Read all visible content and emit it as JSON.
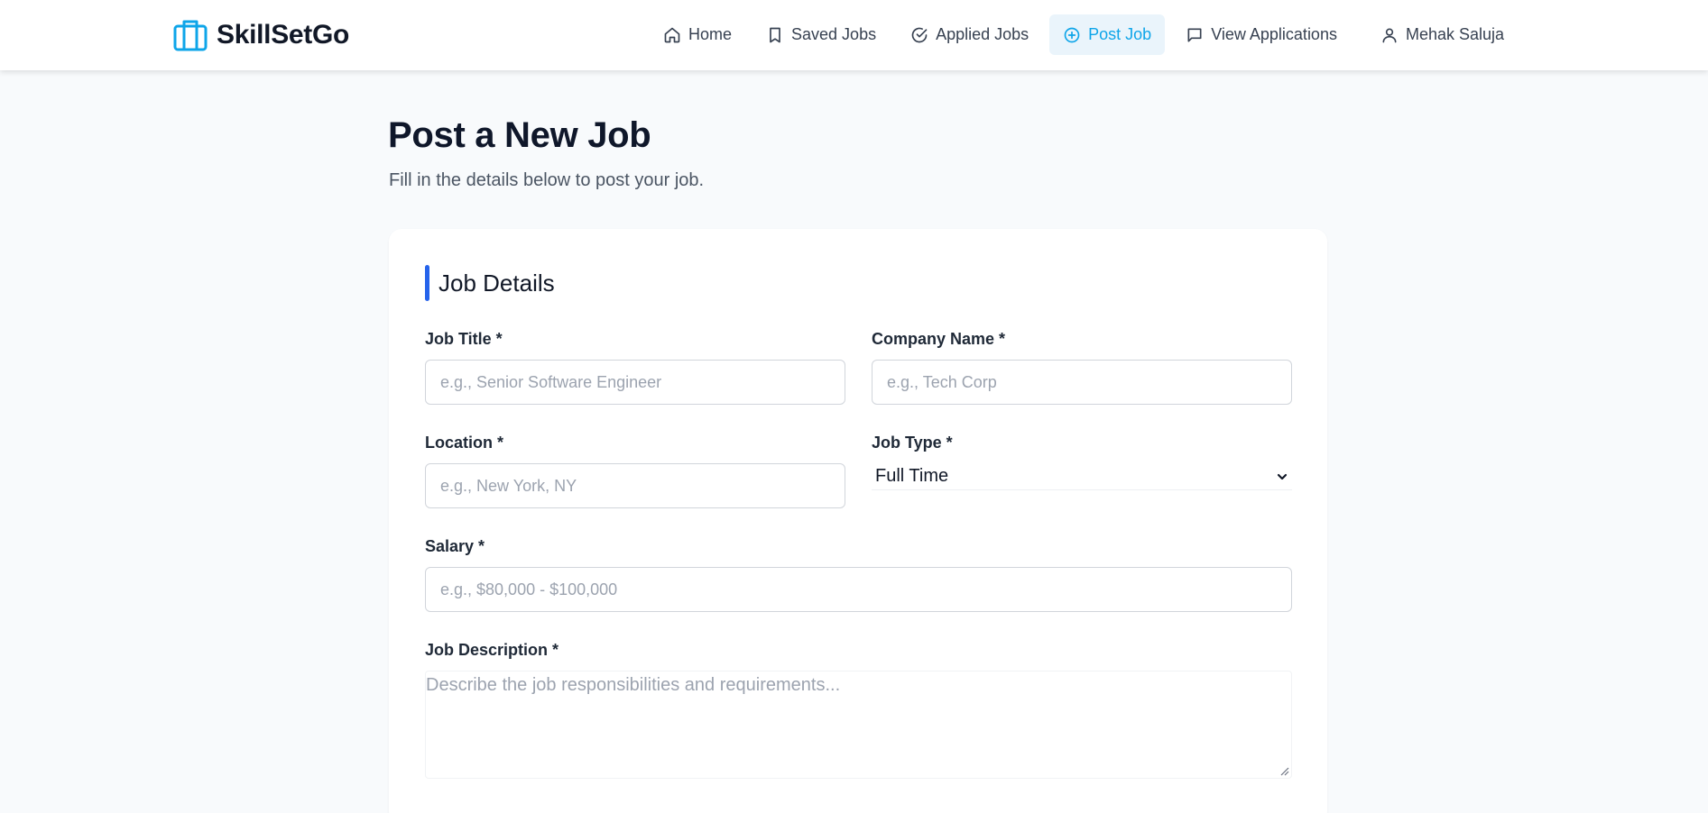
{
  "brand": {
    "name": "SkillSetGo",
    "icon": "briefcase-icon",
    "color": "#0ea5e9"
  },
  "nav": {
    "items": [
      {
        "label": "Home",
        "icon": "home-icon"
      },
      {
        "label": "Saved Jobs",
        "icon": "bookmark-icon"
      },
      {
        "label": "Applied Jobs",
        "icon": "check-circle-icon"
      },
      {
        "label": "Post Job",
        "icon": "plus-circle-icon",
        "active": true
      },
      {
        "label": "View Applications",
        "icon": "message-icon"
      }
    ],
    "profile": {
      "label": "Mehak Saluja",
      "icon": "user-icon"
    }
  },
  "page": {
    "title": "Post a New Job",
    "subtitle": "Fill in the details below to post your job."
  },
  "form": {
    "section_title": "Job Details",
    "accent_color": "#2563eb",
    "job_title": {
      "label": "Job Title *",
      "placeholder": "e.g., Senior Software Engineer",
      "value": ""
    },
    "company_name": {
      "label": "Company Name *",
      "placeholder": "e.g., Tech Corp",
      "value": ""
    },
    "location": {
      "label": "Location *",
      "placeholder": "e.g., New York, NY",
      "value": ""
    },
    "job_type": {
      "label": "Job Type *",
      "value": "Full Time"
    },
    "salary": {
      "label": "Salary *",
      "placeholder": "e.g., $80,000 - $100,000",
      "value": ""
    },
    "job_description": {
      "label": "Job Description *",
      "placeholder": "Describe the job responsibilities and requirements...",
      "value": ""
    }
  }
}
